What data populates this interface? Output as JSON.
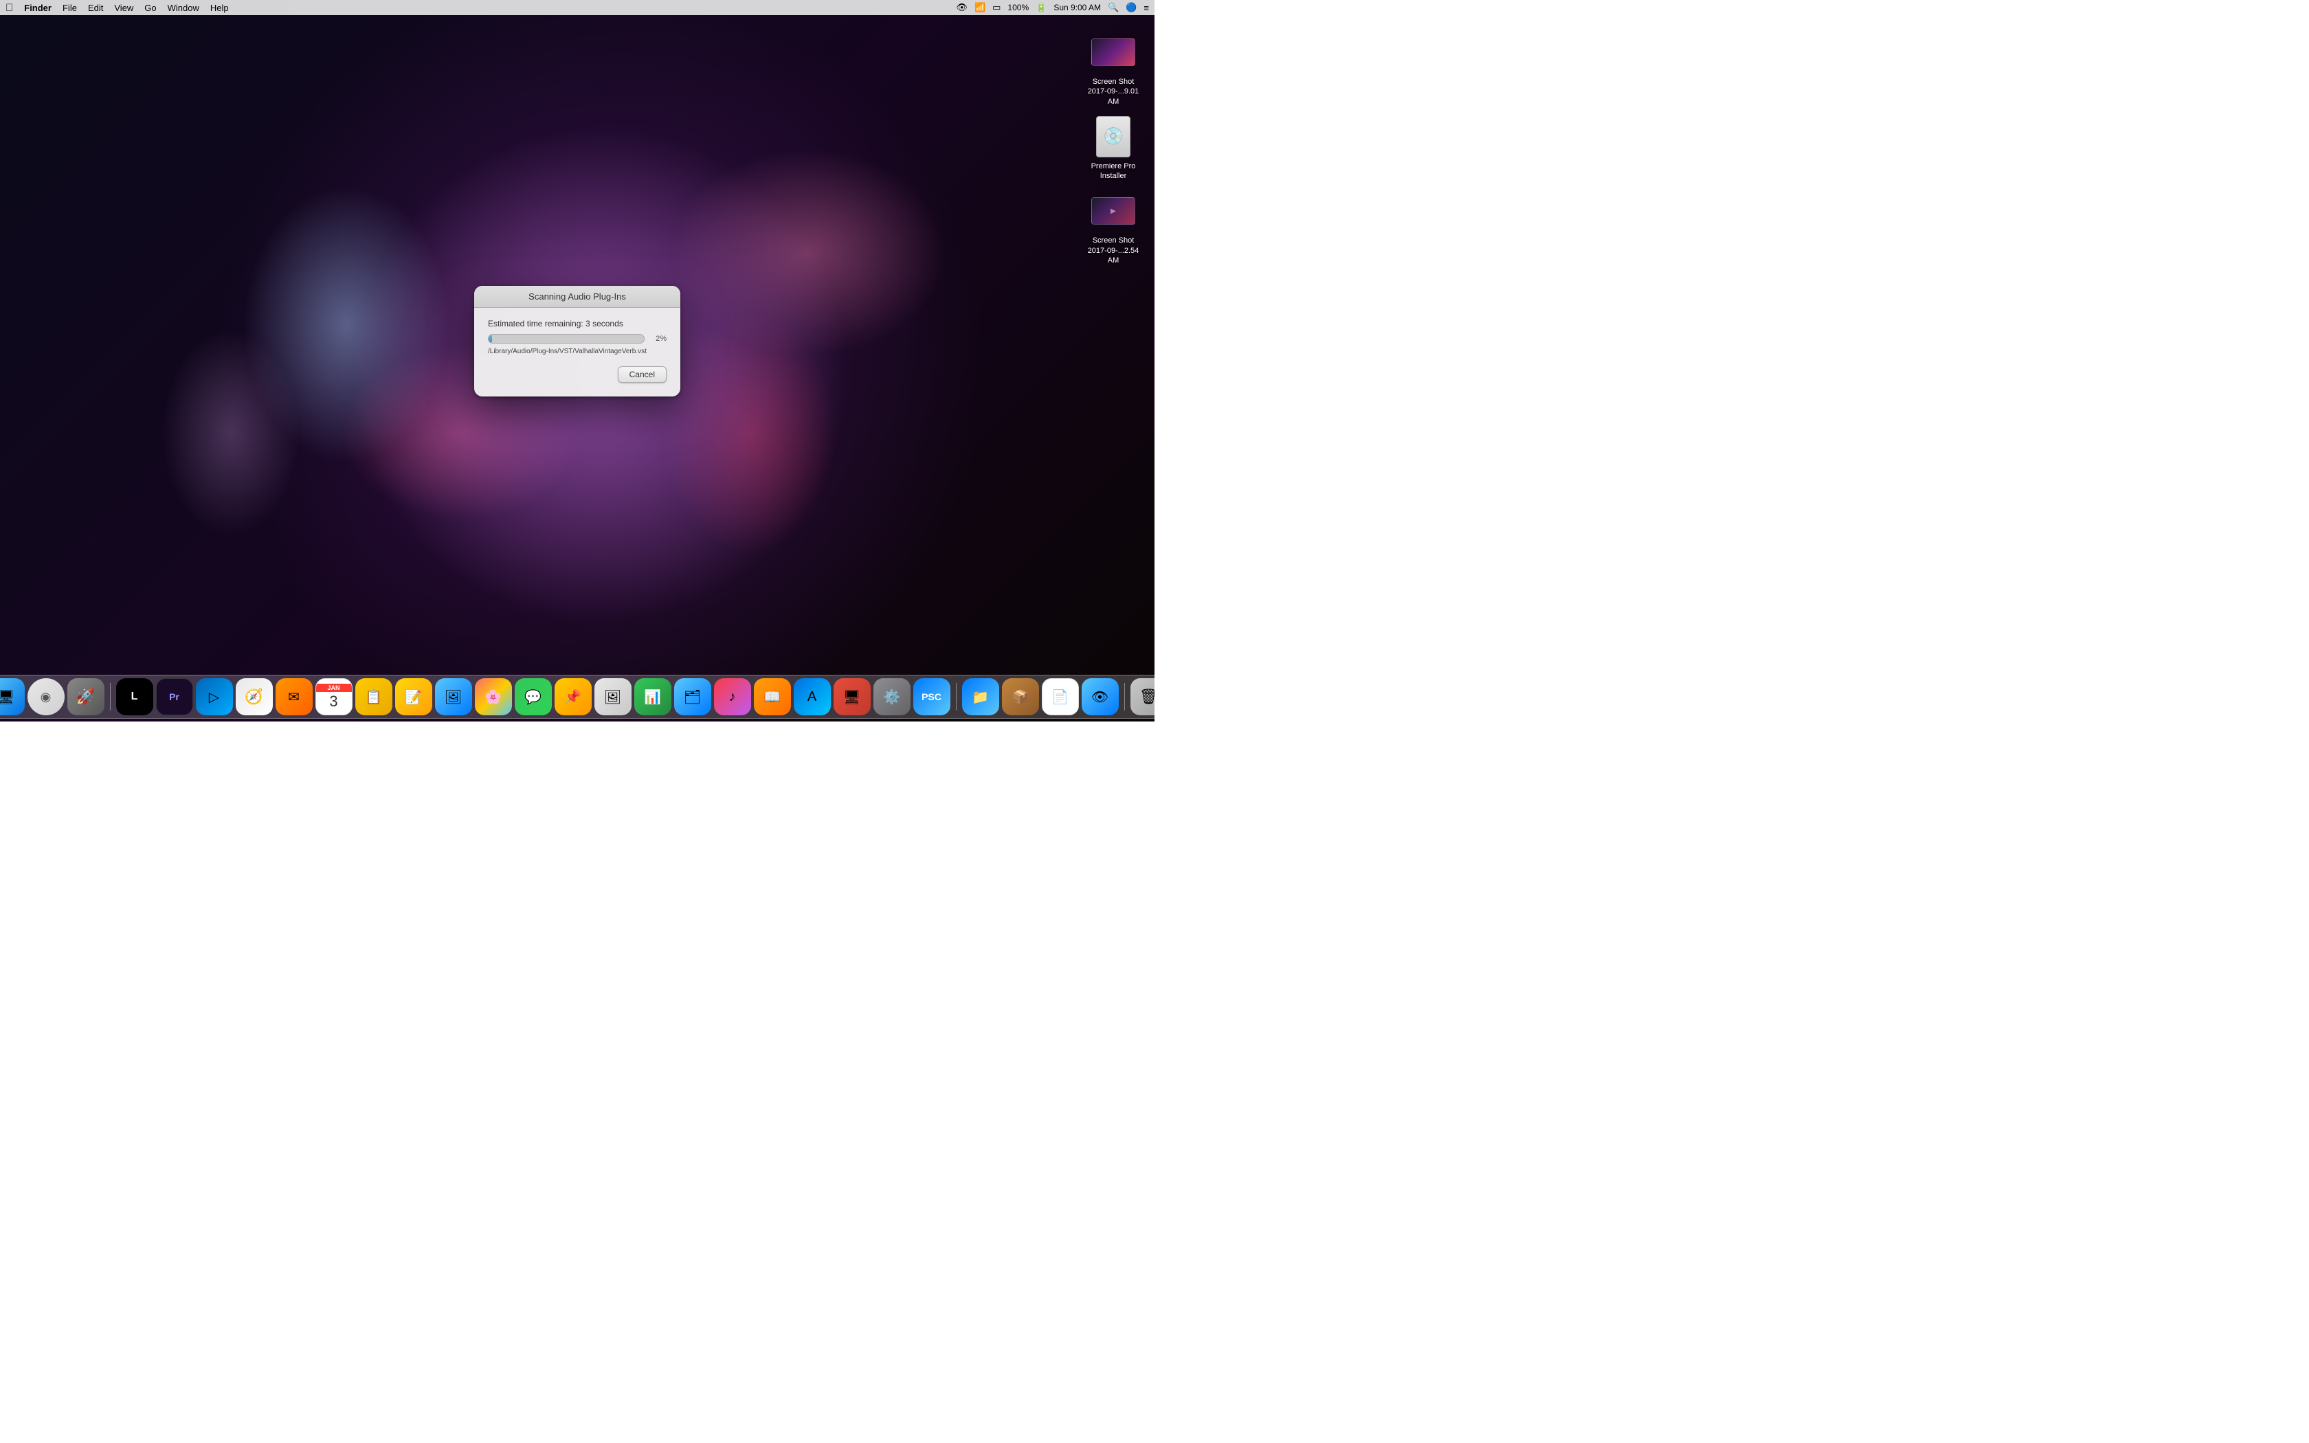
{
  "menubar": {
    "apple": "⌘",
    "app_name": "Finder",
    "menu_items": [
      "File",
      "Edit",
      "View",
      "Go",
      "Window",
      "Help"
    ],
    "status_right": {
      "time": "Sun 9:00 AM",
      "battery": "100%",
      "wifi": "WiFi",
      "spotlight": "🔍",
      "siri_icon": "Siri",
      "airplay": "AirPlay",
      "control": "⊟"
    }
  },
  "desktop": {
    "icons": [
      {
        "id": "screenshot1",
        "label": "Screen Shot\n2017-09-...9.01 AM",
        "type": "screenshot"
      },
      {
        "id": "premiere-installer",
        "label": "Premiere Pro Installer",
        "type": "installer"
      },
      {
        "id": "screenshot2",
        "label": "Screen Shot\n2017-09-...2.54 AM",
        "type": "screenshot2"
      }
    ]
  },
  "dialog": {
    "title": "Scanning Audio Plug-Ins",
    "time_remaining_label": "Estimated time remaining: 3 seconds",
    "progress_percent": "2%",
    "progress_value": 2,
    "path": "/Library/Audio/Plug-Ins/VST/ValhallaVintageVerb.vst",
    "cancel_button": "Cancel"
  },
  "dock": {
    "items": [
      {
        "id": "finder",
        "label": "Finder",
        "emoji": "🖥",
        "class": "dock-finder"
      },
      {
        "id": "siri",
        "label": "Siri",
        "emoji": "◉",
        "class": "dock-siri"
      },
      {
        "id": "launchpad",
        "label": "Launchpad",
        "emoji": "🚀",
        "class": "dock-launchpad"
      },
      {
        "id": "live",
        "label": "Ableton Live",
        "emoji": "L",
        "class": "dock-live"
      },
      {
        "id": "premiere",
        "label": "Adobe Premiere",
        "emoji": "Pr",
        "class": "dock-premiere"
      },
      {
        "id": "vscode",
        "label": "VS Code",
        "emoji": "◈",
        "class": "dock-vscode"
      },
      {
        "id": "safari",
        "label": "Safari",
        "emoji": "◎",
        "class": "dock-safari"
      },
      {
        "id": "letter",
        "label": "Letter Opener",
        "emoji": "✉",
        "class": "dock-letter"
      },
      {
        "id": "calendar",
        "label": "Calendar",
        "emoji": "3",
        "class": "dock-calendar"
      },
      {
        "id": "notefile",
        "label": "Notefile",
        "emoji": "📋",
        "class": "dock-notefile"
      },
      {
        "id": "notes",
        "label": "Notes",
        "emoji": "📝",
        "class": "dock-notes"
      },
      {
        "id": "photos2",
        "label": "Photo slideshow",
        "emoji": "🖼",
        "class": "dock-photos2"
      },
      {
        "id": "photos",
        "label": "Photos",
        "emoji": "⚙",
        "class": "dock-photos"
      },
      {
        "id": "messages",
        "label": "Messages",
        "emoji": "💬",
        "class": "dock-messages"
      },
      {
        "id": "stickies",
        "label": "Stickies",
        "emoji": "📌",
        "class": "dock-stickies"
      },
      {
        "id": "phimage",
        "label": "Photo management",
        "emoji": "🖼",
        "class": "dock-phimage"
      },
      {
        "id": "numbers",
        "label": "Numbers",
        "emoji": "N",
        "class": "dock-numbers"
      },
      {
        "id": "filemanager",
        "label": "File Manager",
        "emoji": "📁",
        "class": "dock-filemanager"
      },
      {
        "id": "itunes",
        "label": "iTunes",
        "emoji": "♪",
        "class": "dock-itunes"
      },
      {
        "id": "ibooks",
        "label": "iBooks",
        "emoji": "📖",
        "class": "dock-ibooks"
      },
      {
        "id": "appstore",
        "label": "App Store",
        "emoji": "A",
        "class": "dock-appstore"
      },
      {
        "id": "screenconnect",
        "label": "Screen Connect",
        "emoji": "🖥",
        "class": "dock-screenconnect"
      },
      {
        "id": "sysprefs",
        "label": "System Preferences",
        "emoji": "⚙",
        "class": "dock-sysprefs"
      },
      {
        "id": "pluginscan",
        "label": "Plugin Scanner",
        "emoji": "P",
        "class": "dock-pluginscan"
      },
      {
        "id": "filemanager2",
        "label": "File Manager 2",
        "emoji": "📂",
        "class": "dock-filemanager2"
      },
      {
        "id": "pkginstaller",
        "label": "Package Installer",
        "emoji": "📦",
        "class": "dock-pkginstaller"
      },
      {
        "id": "text",
        "label": "Text Editor",
        "emoji": "T",
        "class": "dock-text"
      },
      {
        "id": "preview",
        "label": "Preview",
        "emoji": "👁",
        "class": "dock-preview"
      },
      {
        "id": "trash",
        "label": "Trash",
        "emoji": "🗑",
        "class": "dock-trash"
      }
    ]
  }
}
